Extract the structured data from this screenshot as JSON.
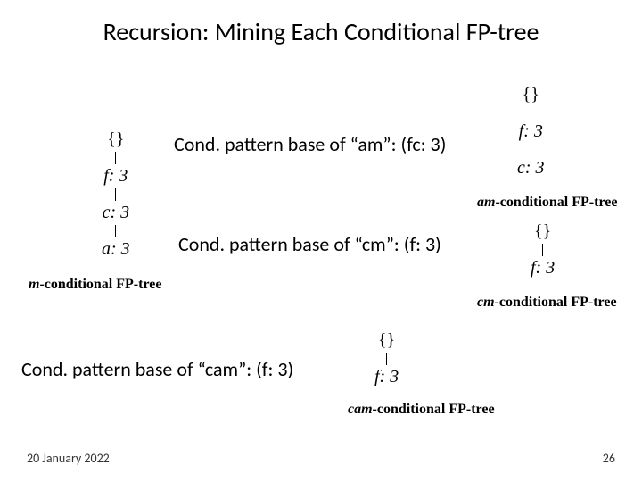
{
  "title": "Recursion: Mining Each Conditional FP-tree",
  "cond_am": "Cond. pattern base of “am”: (fc: 3)",
  "cond_cm": "Cond. pattern base of “cm”: (f: 3)",
  "cond_cam": "Cond. pattern base of “cam”: (f: 3)",
  "captions": {
    "am": {
      "prefix": "am",
      "rest": "-conditional FP-tree"
    },
    "cm": {
      "prefix": "cm",
      "rest": "-conditional FP-tree"
    },
    "m": {
      "prefix": "m",
      "rest": "-conditional FP-tree"
    },
    "cam": {
      "prefix": "cam",
      "rest": "-conditional FP-tree"
    }
  },
  "nodes": {
    "root": "{}",
    "f3": "f: 3",
    "c3": "c: 3",
    "a3": "a: 3"
  },
  "footer": {
    "date": "20 January 2022",
    "page": "26"
  }
}
